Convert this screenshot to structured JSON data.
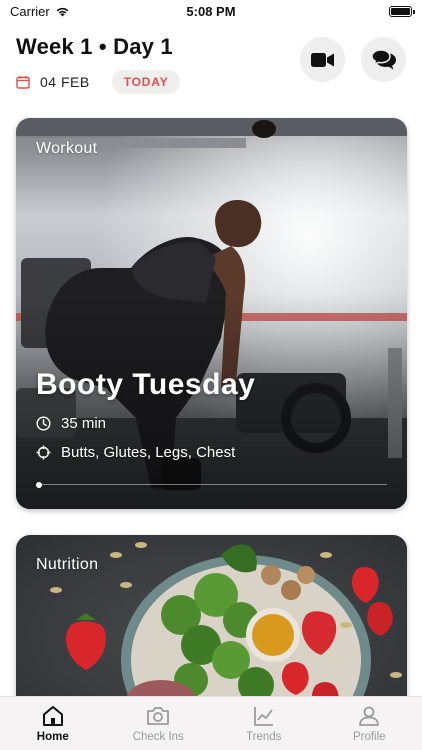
{
  "status_bar": {
    "carrier": "Carrier",
    "time": "5:08 PM"
  },
  "header": {
    "title": "Week 1 • Day 1",
    "date": "04 FEB",
    "today_badge": "TODAY",
    "actions": [
      {
        "icon": "video-camera-icon"
      },
      {
        "icon": "chat-bubbles-icon"
      }
    ]
  },
  "workout_card": {
    "label": "Workout",
    "title": "Booty Tuesday",
    "duration": "35 min",
    "muscles": "Butts, Glutes, Legs, Chest"
  },
  "nutrition_card": {
    "label": "Nutrition"
  },
  "tab_bar": {
    "tabs": [
      {
        "label": "Home",
        "icon": "home-icon",
        "active": true
      },
      {
        "label": "Check Ins",
        "icon": "camera-icon",
        "active": false
      },
      {
        "label": "Trends",
        "icon": "chart-icon",
        "active": false
      },
      {
        "label": "Profile",
        "icon": "person-icon",
        "active": false
      }
    ]
  },
  "colors": {
    "accent": "#e2504c",
    "tab_inactive": "#9b9b9b",
    "badge_bg": "#f1eeee"
  }
}
